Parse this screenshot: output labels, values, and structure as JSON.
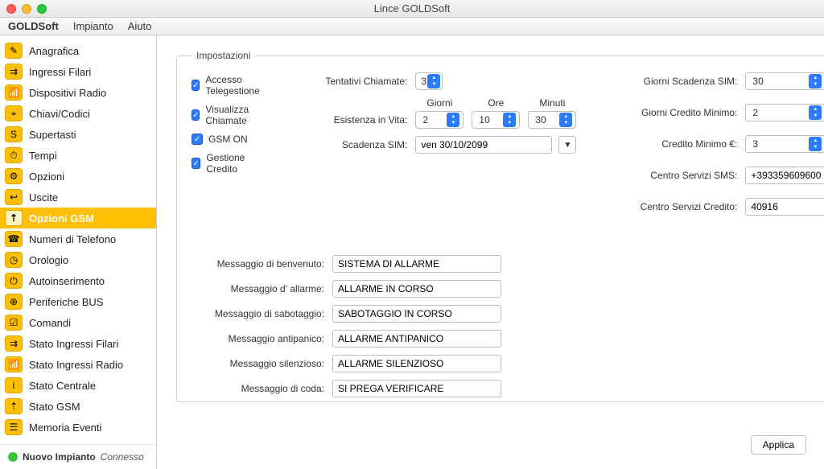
{
  "window": {
    "title": "Lince GOLDSoft"
  },
  "menubar": {
    "m1": "GOLDSoft",
    "m2": "Impianto",
    "m3": "Aiuto"
  },
  "sidebar": {
    "items": [
      {
        "label": "Anagrafica",
        "glyph": "✎"
      },
      {
        "label": "Ingressi Filari",
        "glyph": "⇉"
      },
      {
        "label": "Dispositivi Radio",
        "glyph": "📶"
      },
      {
        "label": "Chiavi/Codici",
        "glyph": "⌖"
      },
      {
        "label": "Supertasti",
        "glyph": "S"
      },
      {
        "label": "Tempi",
        "glyph": "⏱"
      },
      {
        "label": "Opzioni",
        "glyph": "⚙"
      },
      {
        "label": "Uscite",
        "glyph": "↩"
      },
      {
        "label": "Opzioni GSM",
        "glyph": "⇡"
      },
      {
        "label": "Numeri di Telefono",
        "glyph": "☎"
      },
      {
        "label": "Orologio",
        "glyph": "◷"
      },
      {
        "label": "Autoinserimento",
        "glyph": "⏻"
      },
      {
        "label": "Periferiche BUS",
        "glyph": "⊕"
      },
      {
        "label": "Comandi",
        "glyph": "☑"
      },
      {
        "label": "Stato Ingressi Filari",
        "glyph": "⇉"
      },
      {
        "label": "Stato Ingressi Radio",
        "glyph": "📶"
      },
      {
        "label": "Stato Centrale",
        "glyph": "i"
      },
      {
        "label": "Stato GSM",
        "glyph": "⇡"
      },
      {
        "label": "Memoria Eventi",
        "glyph": "☰"
      }
    ],
    "selected": 8
  },
  "status": {
    "bold": "Nuovo Impianto",
    "ital": "Connesso"
  },
  "form": {
    "legend": "Impostazioni",
    "checks": {
      "telegest": "Accesso Telegestione",
      "visChiam": "Visualizza Chiamate",
      "gsmOn": "GSM ON",
      "gestCred": "Gestione Credito"
    },
    "tentativiLbl": "Tentativi Chiamate:",
    "tentativiVal": "3",
    "existLbl": "Esistenza in Vita:",
    "hdrGiorni": "Giorni",
    "hdrOre": "Ore",
    "hdrMinuti": "Minuti",
    "existGiorni": "2",
    "existOre": "10",
    "existMin": "30",
    "scadSimLbl": "Scadenza SIM:",
    "scadSimVal": "ven 30/10/2099",
    "right": {
      "gscadLbl": "Giorni Scadenza SIM:",
      "gscadVal": "30",
      "gcredLbl": "Giorni Credito Minimo:",
      "gcredVal": "2",
      "credMinLbl": "Credito Minimo €:",
      "credMinVal": "3",
      "smsLbl": "Centro Servizi SMS:",
      "smsVal": "+393359609600",
      "credLbl": "Centro Servizi Credito:",
      "credVal": "40916"
    },
    "msgs": {
      "benvLbl": "Messaggio di benvenuto:",
      "benvVal": "SISTEMA DI ALLARME",
      "allrLbl": "Messaggio d' allarme:",
      "allrVal": "ALLARME IN CORSO",
      "sabLbl": "Messaggio di sabotaggio:",
      "sabVal": "SABOTAGGIO IN CORSO",
      "antpLbl": "Messaggio antipanico:",
      "antpVal": "ALLARME ANTIPANICO",
      "silLbl": "Messaggio silenzioso:",
      "silVal": "ALLARME SILENZIOSO",
      "codaLbl": "Messaggio di coda:",
      "codaVal": "SI PREGA VERIFICARE"
    },
    "applyLabel": "Applica"
  }
}
